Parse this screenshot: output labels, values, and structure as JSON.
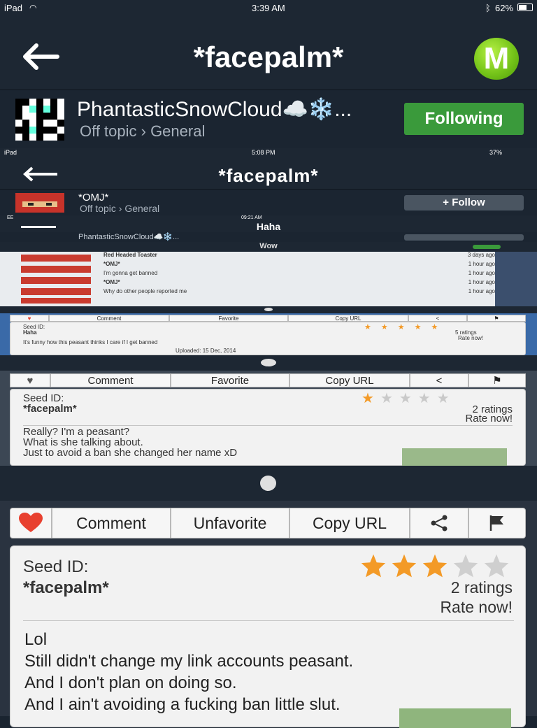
{
  "status": {
    "device": "iPad",
    "time": "3:39 AM",
    "battery": "62%"
  },
  "header": {
    "title": "*facepalm*"
  },
  "author": {
    "name": "PhantasticSnowCloud☁️❄️...",
    "category": "Off topic › General",
    "follow_label": "Following"
  },
  "nested1": {
    "status": {
      "device": "iPad",
      "time": "5:08 PM",
      "battery": "37%"
    },
    "title": "*facepalm*",
    "author": {
      "name": "*OMJ*",
      "category": "Off topic › General",
      "follow_label": "+ Follow"
    }
  },
  "nested2": {
    "status": {
      "carrier": "EE",
      "time": "09:21 AM"
    },
    "title": "Haha",
    "author_name": "PhantasticSnowCloud☁️❄️..."
  },
  "nested3": {
    "title": "Wow",
    "rows": [
      {
        "title": "Red Headed Toaster",
        "sub": "",
        "time": "3 days ago"
      },
      {
        "title": "*OMJ*",
        "sub": "",
        "time": "1 hour ago"
      },
      {
        "title": "",
        "sub": "I'm gonna get banned",
        "time": "1 hour ago"
      },
      {
        "title": "*OMJ*",
        "sub": "",
        "time": "1 hour ago"
      },
      {
        "title": "",
        "sub": "Why do other people reported me",
        "time": "1 hour ago"
      }
    ]
  },
  "nested_haha_card": {
    "actions": {
      "comment": "Comment",
      "favorite": "Favorite",
      "copy": "Copy URL"
    },
    "seed_label": "Seed ID:",
    "seed_value": "Haha",
    "ratings": "5 ratings",
    "rate_now": "Rate now!",
    "text": "It's funny how this peasant thinks I care if I get banned",
    "uploaded": "Uploaded: 15 Dec, 2014"
  },
  "nested_facepalm_card": {
    "actions": {
      "comment": "Comment",
      "favorite": "Favorite",
      "copy": "Copy URL"
    },
    "seed_label": "Seed ID:",
    "seed_value": "*facepalm*",
    "ratings": "2 ratings",
    "rate_now": "Rate now!",
    "lines": [
      "Really? I'm a peasant?",
      "What is she talking about.",
      "Just to avoid a ban she changed her name xD"
    ]
  },
  "main_card": {
    "actions": {
      "comment": "Comment",
      "favorite": "Unfavorite",
      "copy": "Copy URL"
    },
    "seed_label": "Seed ID:",
    "seed_value": "*facepalm*",
    "rating_value": 3,
    "rating_max": 5,
    "ratings": "2 ratings",
    "rate_now": "Rate now!",
    "lines": [
      "Lol",
      "Still didn't change my link accounts peasant.",
      "And I don't plan on doing so.",
      "And I ain't avoiding a fucking ban little slut."
    ]
  },
  "colors": {
    "accent_green": "#3a9a3b",
    "star_on": "#f39a27",
    "heart": "#e8402f",
    "bg_dark": "#1d2733"
  }
}
